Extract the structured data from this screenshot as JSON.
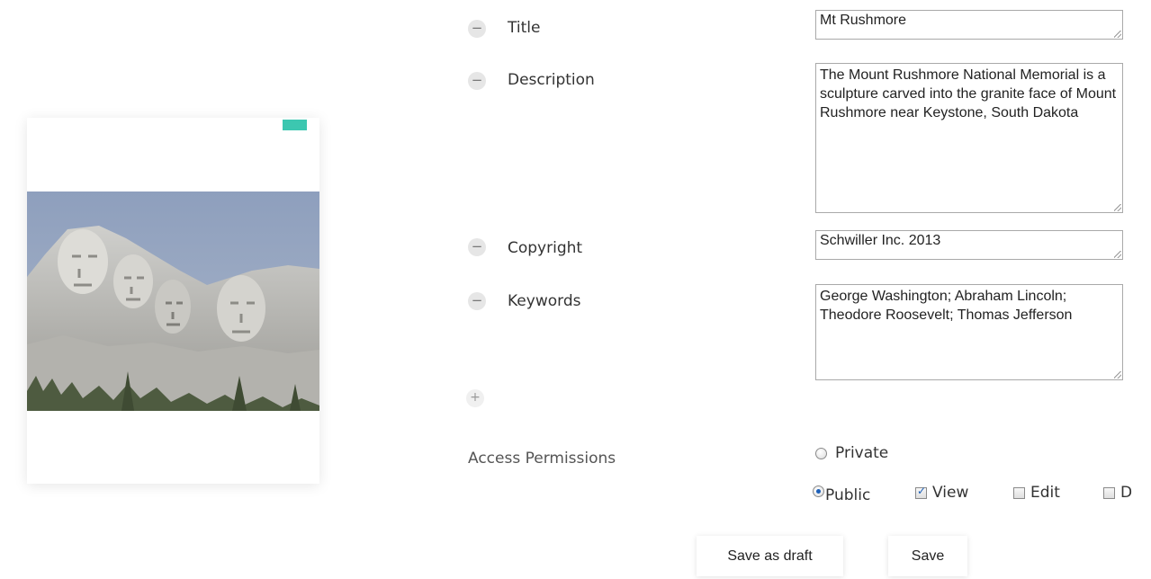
{
  "fields": {
    "title": {
      "label": "Title",
      "value": "Mt Rushmore"
    },
    "description": {
      "label": "Description",
      "value": "The Mount Rushmore National Memorial is a sculpture carved into the granite face of Mount Rushmore near Keystone, South Dakota"
    },
    "copyright": {
      "label": "Copyright",
      "value": "Schwiller Inc. 2013"
    },
    "keywords": {
      "label": "Keywords",
      "value": "George Washington; Abraham Lincoln; Theodore Roosevelt; Thomas Jefferson"
    }
  },
  "add_field_icon": "plus-icon",
  "remove_field_icon": "minus-icon",
  "permissions": {
    "label": "Access Permissions",
    "private_label": "Private",
    "public_label": "Public",
    "selected": "Public",
    "view_label": "View",
    "edit_label": "Edit",
    "third_label": "D",
    "view_checked": true,
    "edit_checked": false
  },
  "buttons": {
    "save_draft": "Save as draft",
    "save": "Save"
  },
  "colors": {
    "accent": "#3cc7b0",
    "radio_dot": "#1c5fb8"
  }
}
